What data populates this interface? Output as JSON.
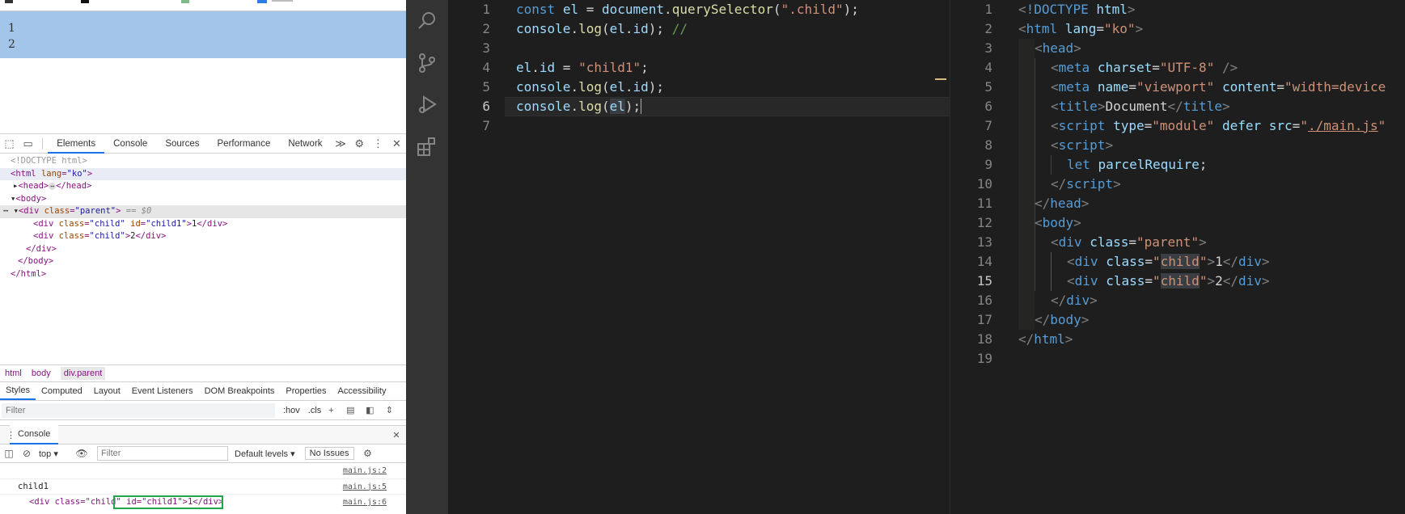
{
  "browser": {
    "page_lines": [
      "1",
      "2"
    ],
    "devtools_tabs": [
      "Elements",
      "Console",
      "Sources",
      "Performance",
      "Network"
    ],
    "more_tabs_glyph": "≫",
    "elements_tree": {
      "doctype": "<!DOCTYPE html>",
      "html_open_tag": "html",
      "html_lang_attr": "lang",
      "html_lang_val": "\"ko\"",
      "head_collapsed": "</head>",
      "body_tag": "body",
      "parent_div_class_val": "\"parent\"",
      "eq_marker": "== $0",
      "child1_class_val": "\"child\"",
      "child1_id_val": "\"child1\"",
      "child1_text": "1",
      "child2_class_val": "\"child\"",
      "child2_text": "2",
      "div_close": "</div>",
      "body_close": "</body>",
      "html_close": "</html>"
    },
    "breadcrumbs": [
      "html",
      "body",
      "div.parent"
    ],
    "styles_tabs": [
      "Styles",
      "Computed",
      "Layout",
      "Event Listeners",
      "DOM Breakpoints",
      "Properties",
      "Accessibility"
    ],
    "styles_filter_placeholder": "Filter",
    "styles_options": [
      ":hov",
      ".cls"
    ],
    "drawer_title": "Console",
    "console_context": "top",
    "console_filter_placeholder": "Filter",
    "console_levels": "Default levels",
    "console_issues": "No Issues",
    "console_messages": [
      {
        "text": "",
        "source": "main.js:2"
      },
      {
        "text": "child1",
        "source": "main.js:5"
      },
      {
        "text_pre": "<div class=\"child\"",
        "text_hl": " id=\"child1\">1</div>",
        "source": "main.js:6"
      }
    ]
  },
  "editor_left": {
    "line_numbers": [
      "1",
      "2",
      "3",
      "4",
      "5",
      "6",
      "7"
    ],
    "current_line": "6"
  },
  "editor_right": {
    "line_numbers": [
      "1",
      "2",
      "3",
      "4",
      "5",
      "6",
      "7",
      "8",
      "9",
      "10",
      "11",
      "12",
      "13",
      "14",
      "15",
      "16",
      "17",
      "18",
      "19"
    ],
    "current_line": "15"
  },
  "colors": {
    "editor_bg": "#1e1e1e",
    "activity_bar": "#333333",
    "page_bg": "#a3c5ea",
    "highlight_box": "#1fa64a",
    "devtools_accent": "#1a73e8"
  }
}
